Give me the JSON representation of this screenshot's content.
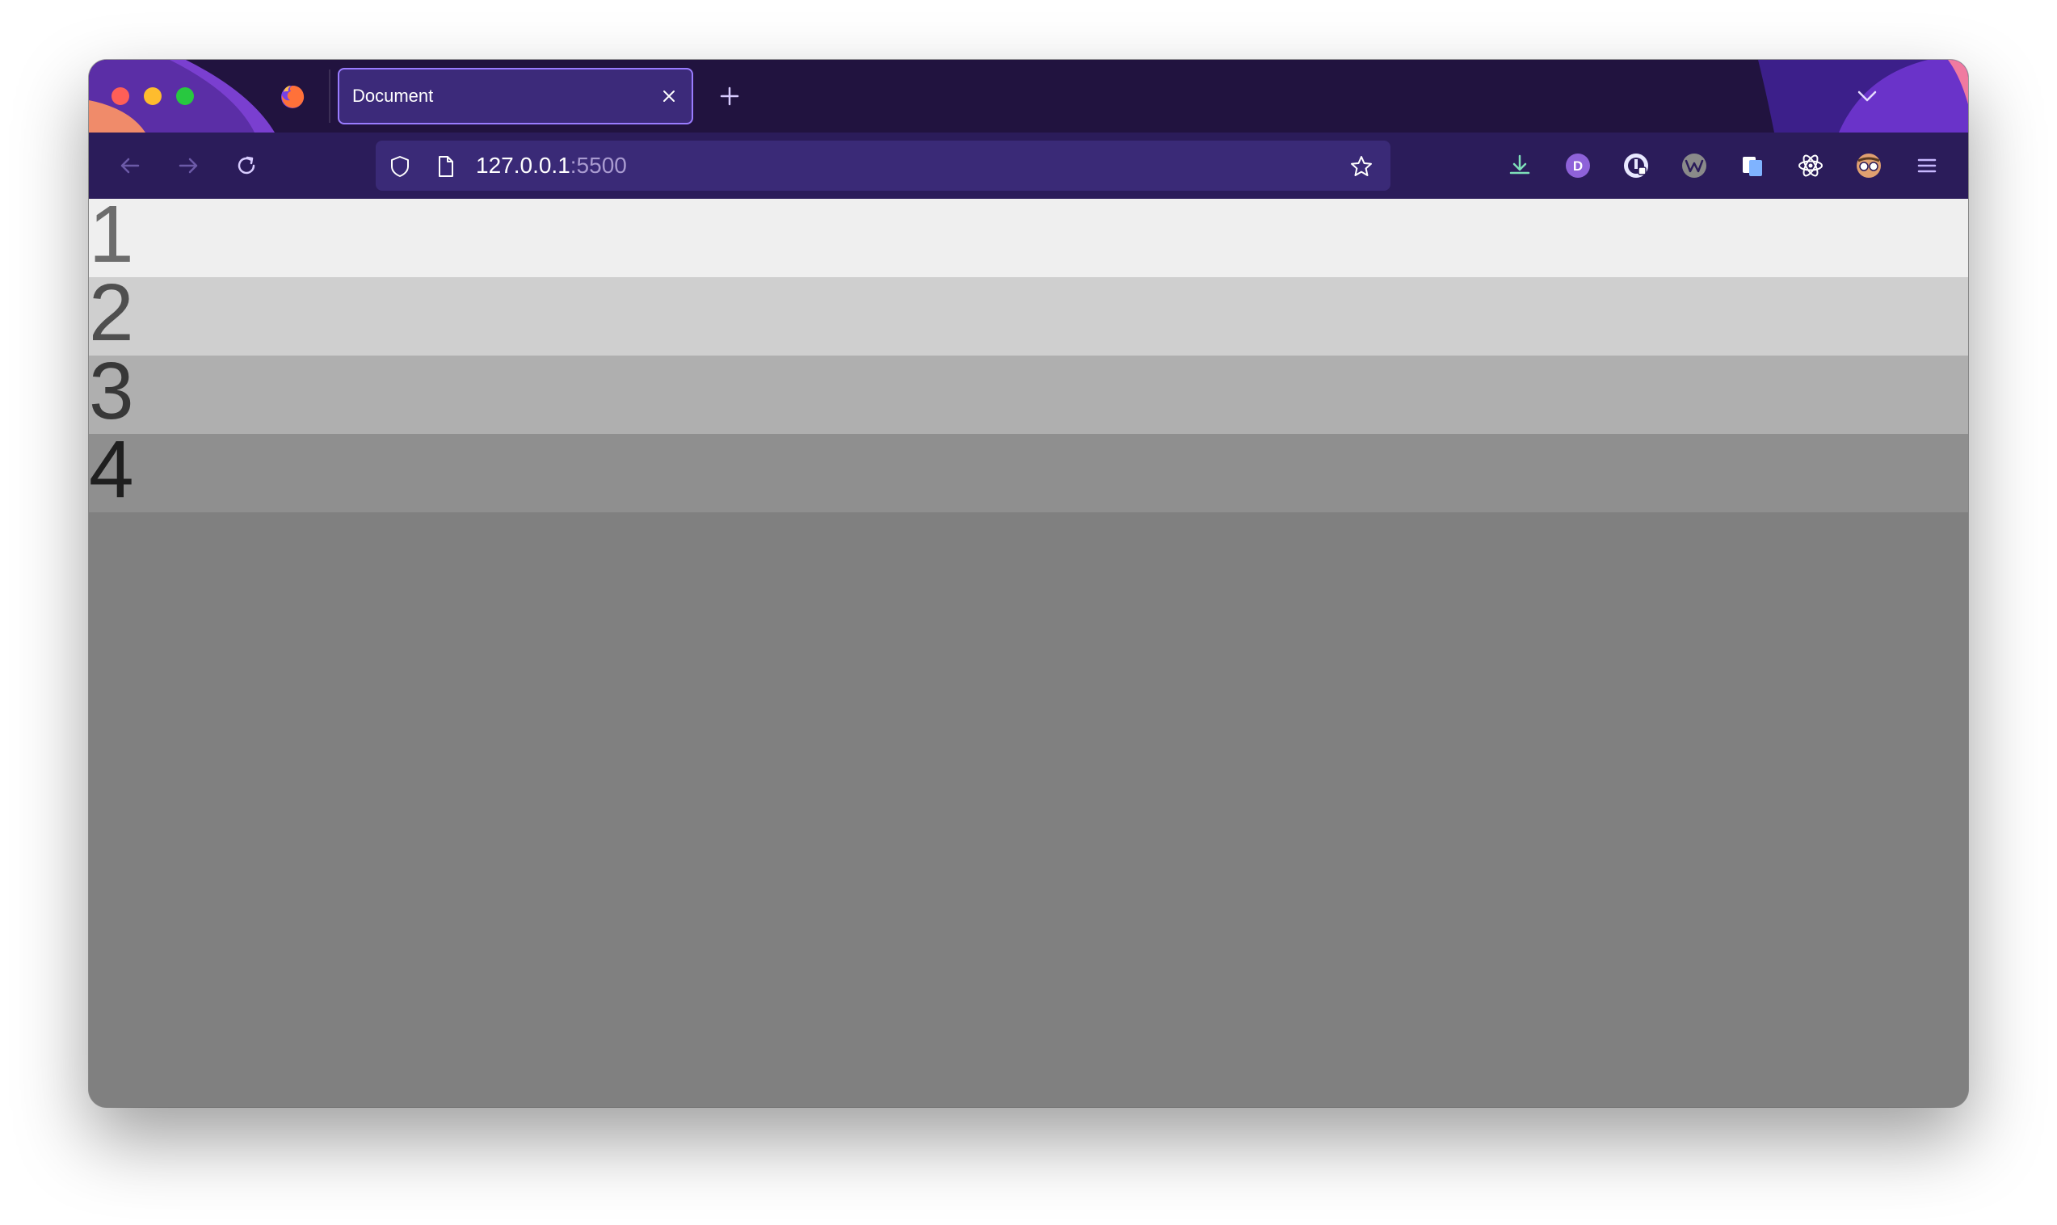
{
  "browser": {
    "tab": {
      "title": "Document",
      "close_icon": "close-icon"
    },
    "new_tab_icon": "plus-icon",
    "tab_list_icon": "chevron-down-icon",
    "toolbar": {
      "back_icon": "arrow-left-icon",
      "forward_icon": "arrow-right-icon",
      "reload_icon": "reload-icon",
      "url_host": "127.0.0.1",
      "url_port": ":5500",
      "tracking_icon": "shield-icon",
      "page_icon": "document-icon",
      "bookmark_icon": "star-icon",
      "extensions": [
        {
          "icon": "download-icon",
          "color": "#7ee0b9"
        },
        {
          "icon": "extension-d-icon",
          "label": "D",
          "color": "#8e62d9"
        },
        {
          "icon": "extension-vault-icon",
          "color": "#e8e8ff"
        },
        {
          "icon": "extension-wave-icon",
          "color": "#8a8a8a"
        },
        {
          "icon": "extension-cards-icon",
          "color": "#7fb3ff"
        },
        {
          "icon": "react-devtools-icon",
          "color": "#ffffff"
        },
        {
          "icon": "extension-mask-icon",
          "color": "#e0a070"
        },
        {
          "icon": "menu-icon",
          "color": "#c8b8ff"
        }
      ]
    }
  },
  "page": {
    "rows": [
      {
        "label": "1",
        "color": "#efefef"
      },
      {
        "label": "2",
        "color": "#cfcfcf"
      },
      {
        "label": "3",
        "color": "#afafaf"
      },
      {
        "label": "4",
        "color": "#8f8f8f"
      }
    ],
    "body_color": "#808080"
  }
}
